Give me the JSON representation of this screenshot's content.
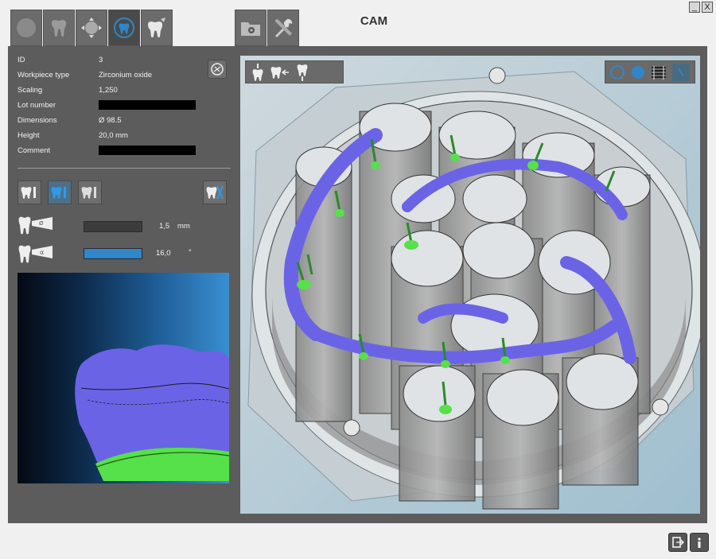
{
  "window": {
    "title": "CAM",
    "minimize_label": "",
    "close_label": "X"
  },
  "tabs": [
    {
      "icon": "circle-blank-icon",
      "active": false
    },
    {
      "icon": "tooth-icon",
      "active": false
    },
    {
      "icon": "move-tooth-icon",
      "active": false
    },
    {
      "icon": "tooth-sprue-icon",
      "active": true
    },
    {
      "icon": "tooth-brush-icon",
      "active": false
    },
    {
      "icon": "folder-gear-icon",
      "active": false
    },
    {
      "icon": "tools-icon",
      "active": false
    }
  ],
  "properties": {
    "id_label": "ID",
    "id_value": "3",
    "workpiece_label": "Workpiece type",
    "workpiece_value": "Zirconium oxide",
    "scaling_label": "Scaling",
    "scaling_value": "1,250",
    "lot_label": "Lot number",
    "lot_value": "",
    "dimensions_label": "Dimensions",
    "dimensions_value": "Ø 98.5",
    "height_label": "Height",
    "height_value": "20,0   mm",
    "comment_label": "Comment",
    "comment_value": ""
  },
  "tooth_modes": [
    {
      "icon": "tooth-sprue-one-icon",
      "selected": false
    },
    {
      "icon": "tooth-sprue-one-icon",
      "selected": true
    },
    {
      "icon": "tooth-sprue-one-icon",
      "selected": false
    }
  ],
  "sliders": {
    "diameter_value": "1,5",
    "diameter_unit": "mm",
    "angle_value": "16,0",
    "angle_unit": "°",
    "angle_fill": 1.0
  },
  "colors": {
    "accent": "#2f86c9",
    "frame": "#5c5c5c",
    "model": "#6b63e6",
    "contact": "#56e04a"
  }
}
